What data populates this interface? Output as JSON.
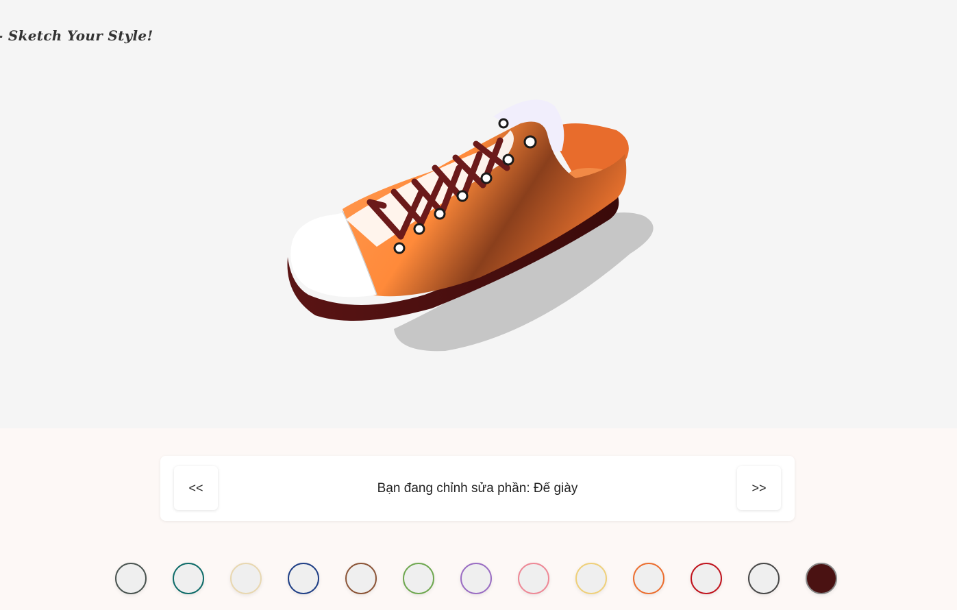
{
  "brand": {
    "title": "- Sketch Your Style!"
  },
  "editor": {
    "prev_label": "<<",
    "next_label": ">>",
    "status_text": "Bạn đang chỉnh sửa phần: Đế giày"
  },
  "shoe_colors": {
    "upper": "#ff8533",
    "toe_cap": "#ffffff",
    "collar_back": "#f0ecff",
    "laces": "#6b1a1a",
    "sole": "#5a1414",
    "eyelet": "#ffffff"
  },
  "swatches": [
    {
      "name": "gray",
      "border": "#4a5450",
      "fill": "#efefef"
    },
    {
      "name": "teal",
      "border": "#0d6b68",
      "fill": "#efefef"
    },
    {
      "name": "beige",
      "border": "#e8d7b0",
      "fill": "#efefef"
    },
    {
      "name": "navy",
      "border": "#1f3f86",
      "fill": "#efefef"
    },
    {
      "name": "brown",
      "border": "#8b5436",
      "fill": "#efefef"
    },
    {
      "name": "green",
      "border": "#6fa850",
      "fill": "#efefef"
    },
    {
      "name": "purple",
      "border": "#9a6dc3",
      "fill": "#efefef"
    },
    {
      "name": "pink",
      "border": "#ee8896",
      "fill": "#efefef"
    },
    {
      "name": "yellow",
      "border": "#efd07a",
      "fill": "#efefef"
    },
    {
      "name": "orange",
      "border": "#ec6e2f",
      "fill": "#efefef"
    },
    {
      "name": "red",
      "border": "#c0121c",
      "fill": "#efefef"
    },
    {
      "name": "charcoal",
      "border": "#484848",
      "fill": "#efefef"
    },
    {
      "name": "maroon",
      "border": "#888888",
      "fill": "#4a1212",
      "selected": true
    }
  ]
}
